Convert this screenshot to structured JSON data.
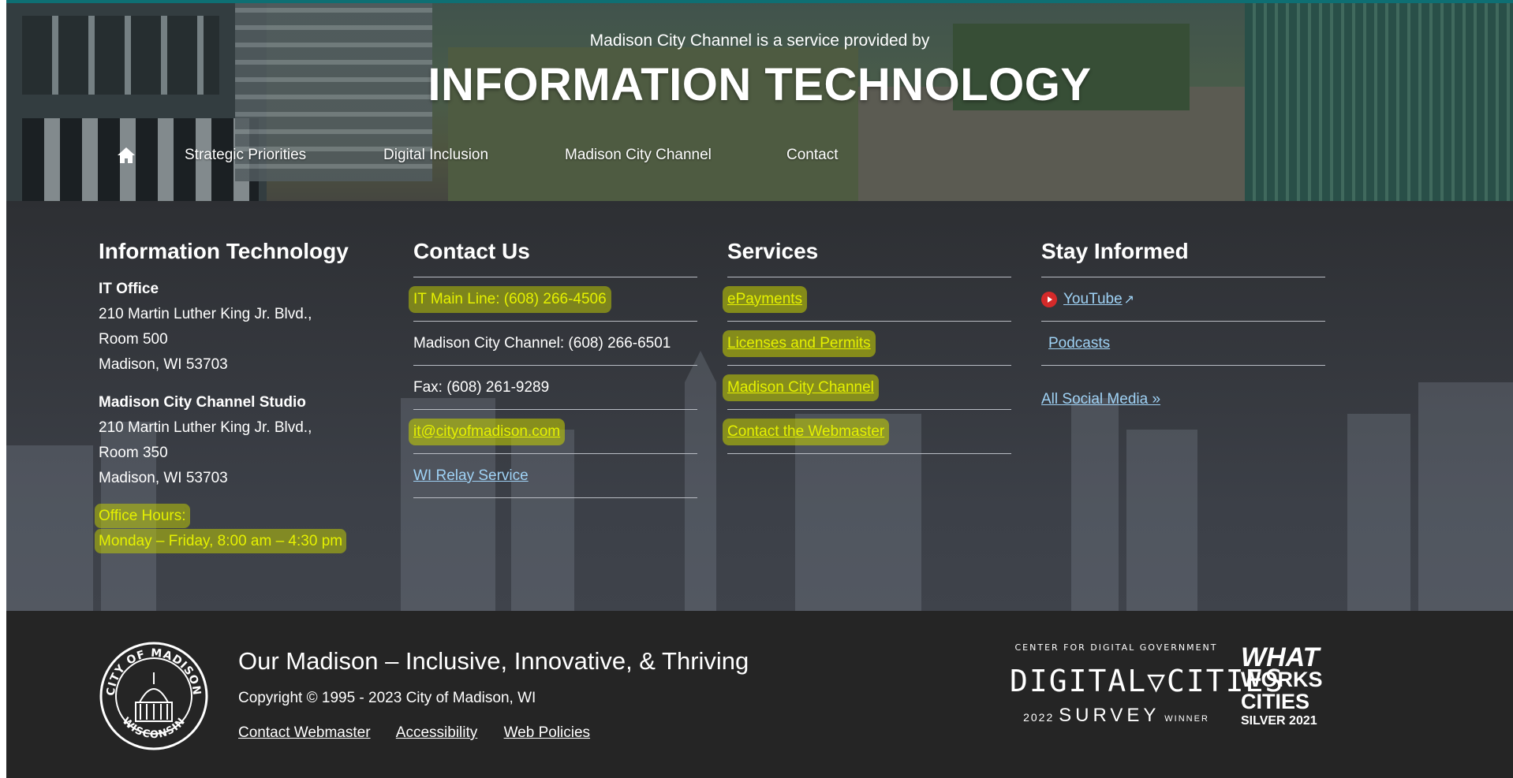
{
  "hero": {
    "intro": "Madison City Channel is a service provided by",
    "title": "INFORMATION TECHNOLOGY",
    "nav": [
      {
        "label": "Strategic Priorities"
      },
      {
        "label": "Digital Inclusion"
      },
      {
        "label": "Madison City Channel"
      },
      {
        "label": "Contact"
      }
    ]
  },
  "info": {
    "it": {
      "heading": "Information Technology",
      "office_name": "IT Office",
      "office_lines": [
        "210 Martin Luther King Jr. Blvd.,",
        "Room 500",
        "Madison, WI 53703"
      ],
      "studio_name": "Madison City Channel Studio",
      "studio_lines": [
        "210 Martin Luther King Jr. Blvd.,",
        "Room 350",
        "Madison, WI 53703"
      ],
      "hours_label": "Office Hours:",
      "hours_value": "Monday – Friday, 8:00 am – 4:30 pm"
    },
    "contact": {
      "heading": "Contact Us",
      "items": [
        {
          "text": "IT Main Line: (608) 266-4506"
        },
        {
          "text": "Madison City Channel: (608) 266-6501"
        },
        {
          "text": "Fax: (608) 261-9289"
        },
        {
          "text": "it@cityofmadison.com"
        },
        {
          "text": "WI Relay Service"
        }
      ]
    },
    "services": {
      "heading": "Services",
      "items": [
        {
          "text": "ePayments"
        },
        {
          "text": "Licenses and Permits"
        },
        {
          "text": "Madison City Channel"
        },
        {
          "text": "Contact the Webmaster"
        }
      ]
    },
    "stay": {
      "heading": "Stay Informed",
      "items": [
        {
          "text": "YouTube",
          "icon": "youtube-icon"
        },
        {
          "text": "Podcasts"
        }
      ],
      "all_social": "All Social Media »"
    }
  },
  "footer": {
    "seal_top": "CITY OF MADISON",
    "seal_bottom": "WISCONSIN",
    "tagline": "Our Madison – Inclusive, Innovative, & Thriving",
    "copyright": "Copyright © 1995 - 2023 City of Madison, WI",
    "links": [
      {
        "label": "Contact Webmaster"
      },
      {
        "label": "Accessibility"
      },
      {
        "label": "Web Policies"
      }
    ],
    "dc_award": {
      "top": "CENTER FOR DIGITAL GOVERNMENT",
      "main_left": "DIGITAL",
      "main_right": "CITIES",
      "year": "2022",
      "survey": "SURVEY",
      "winner": "WINNER"
    },
    "ww_award": {
      "line1": "WHAT",
      "line2": "WORKS",
      "line3": "CITIES",
      "line4": "SILVER 2021"
    }
  },
  "colors": {
    "highlight": "#c8d400",
    "link": "#9fd2f5",
    "footer_bg": "#252525",
    "teal_top": "#0e6f73"
  }
}
